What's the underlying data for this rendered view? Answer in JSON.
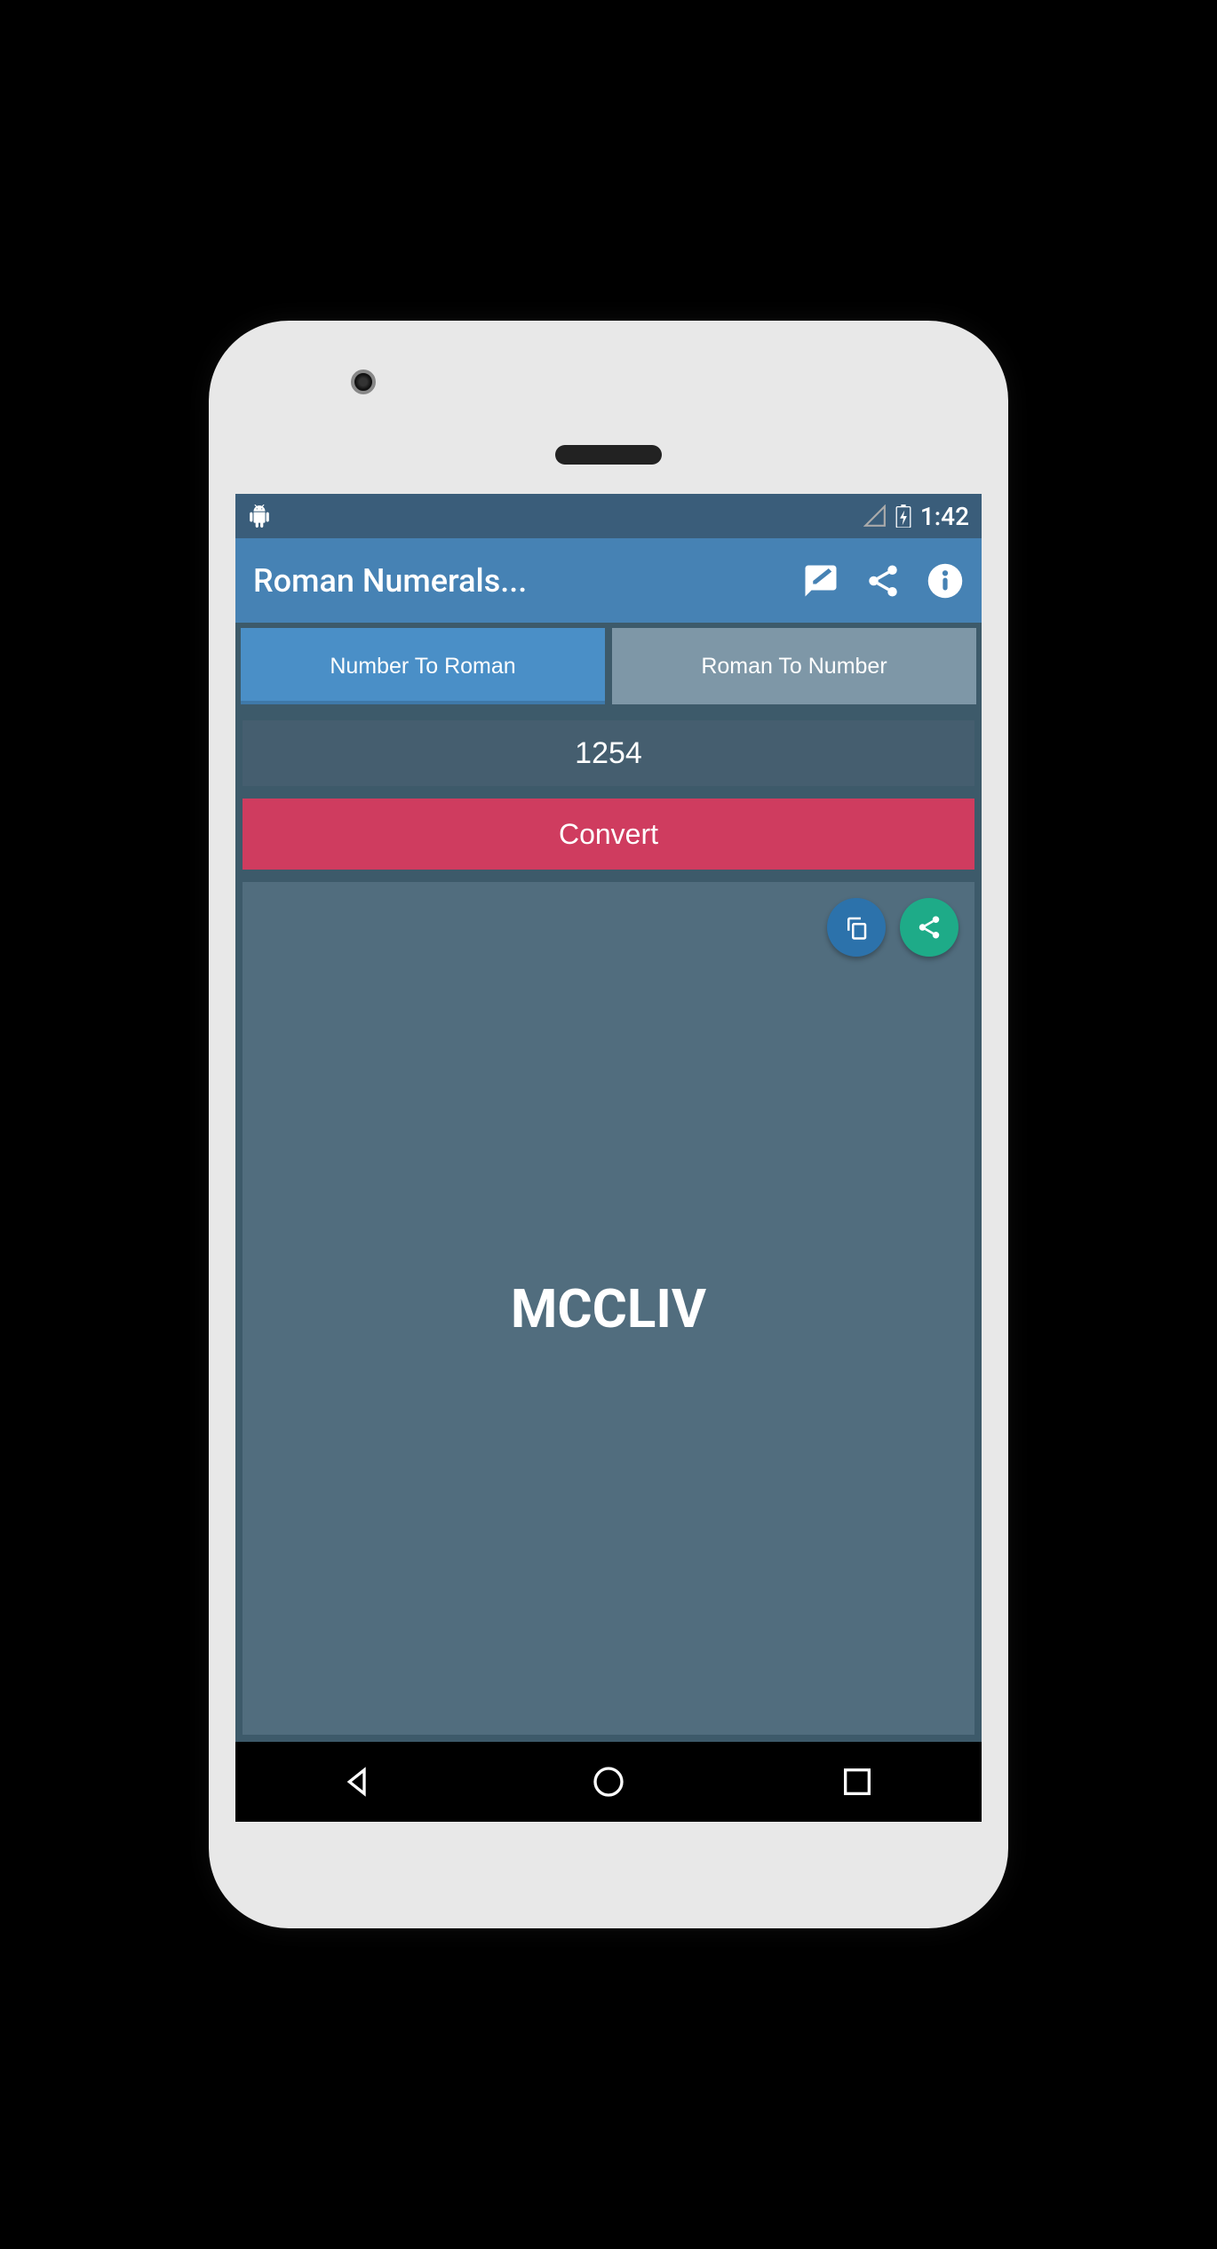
{
  "status": {
    "time": "1:42"
  },
  "app": {
    "title": "Roman Numerals..."
  },
  "tabs": {
    "active": "Number To Roman",
    "inactive": "Roman To Number"
  },
  "input": {
    "value": "1254"
  },
  "actions": {
    "convert": "Convert"
  },
  "result": {
    "value": "MCCLIV"
  }
}
